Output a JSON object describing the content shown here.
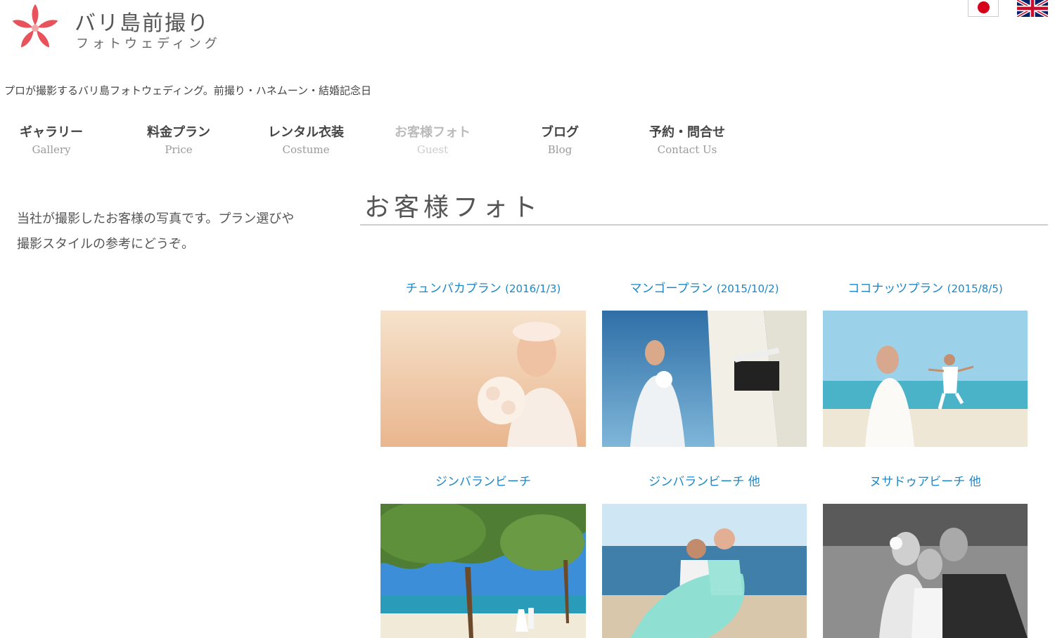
{
  "header": {
    "logo_title": "バリ島前撮り",
    "logo_subtitle": "フォトウェディング",
    "language_flags": [
      {
        "icon": "japan-flag-icon"
      },
      {
        "icon": "uk-flag-icon"
      }
    ]
  },
  "tagline": "プロが撮影するバリ島フォトウェディング。前撮り・ハネムーン・結婚記念日",
  "nav": {
    "items": [
      {
        "jp": "ギャラリー",
        "en": "Gallery"
      },
      {
        "jp": "料金プラン",
        "en": "Price"
      },
      {
        "jp": "レンタル衣装",
        "en": "Costume"
      },
      {
        "jp": "お客様フォト",
        "en": "Guest",
        "active": true
      },
      {
        "jp": "ブログ",
        "en": "Blog"
      },
      {
        "jp": "予約・問合せ",
        "en": "Contact Us"
      }
    ]
  },
  "intro": {
    "line1": "当社が撮影したお客様の写真です。プラン選びや",
    "line2": "撮影スタイルの参考にどうぞ。"
  },
  "page_title": "お客様フォト",
  "gallery": [
    {
      "title": "チュンパカプラン",
      "date": "(2016/1/3)"
    },
    {
      "title": "マンゴープラン",
      "date": "(2015/10/2)"
    },
    {
      "title": "ココナッツプラン",
      "date": "(2015/8/5)"
    },
    {
      "title": "ジンバランビーチ",
      "date": ""
    },
    {
      "title": "ジンバランビーチ 他",
      "date": ""
    },
    {
      "title": "ヌサドゥアビーチ 他",
      "date": ""
    }
  ],
  "colors": {
    "link": "#1a88c9",
    "logo_flower": "#e8525a"
  }
}
